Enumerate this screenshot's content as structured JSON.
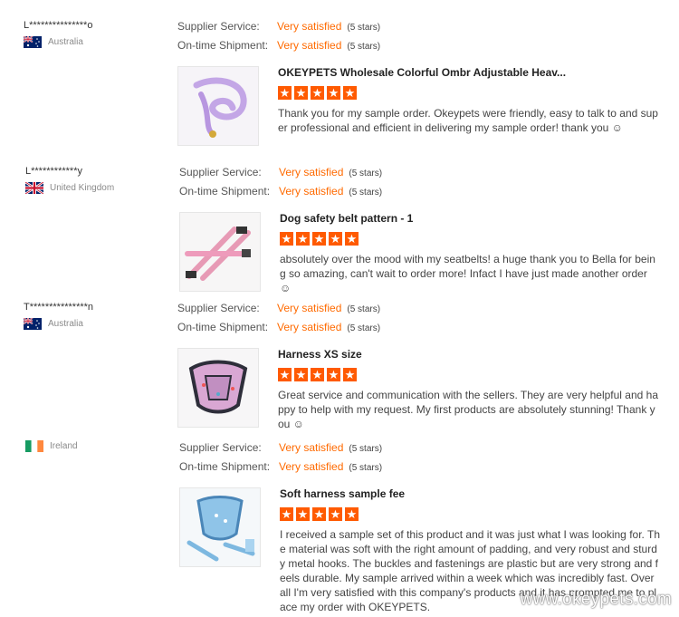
{
  "labels": {
    "supplier_service": "Supplier Service:",
    "ontime_shipment": "On-time Shipment:"
  },
  "accent_color": "#ff6a00",
  "star_color": "#ff5a00",
  "reviews": [
    {
      "buyer": "L***************o",
      "country": "Australia",
      "flag_icon": "australia-flag-icon",
      "supplier_value": "Very satisfied",
      "supplier_stars": "(5 stars)",
      "shipment_value": "Very satisfied",
      "shipment_stars": "(5 stars)",
      "product_title": "OKEYPETS Wholesale Colorful Ombr Adjustable Heav...",
      "rating": 5,
      "comment": "Thank you for my sample order. Okeypets were friendly, easy to talk to and super professional and efficient in delivering my sample order! thank you ☺"
    },
    {
      "buyer": "L************y",
      "country": "United Kingdom",
      "flag_icon": "united-kingdom-flag-icon",
      "supplier_value": "Very satisfied",
      "supplier_stars": "(5 stars)",
      "shipment_value": "Very satisfied",
      "shipment_stars": "(5 stars)",
      "product_title": "Dog safety belt pattern - 1",
      "rating": 5,
      "comment": "absolutely over the mood with my seatbelts! a huge thank you to Bella for being so amazing, can't wait to order more! Infact I have just made another order ☺"
    },
    {
      "buyer": "T***************n",
      "country": "Australia",
      "flag_icon": "australia-flag-icon",
      "supplier_value": "Very satisfied",
      "supplier_stars": "(5 stars)",
      "shipment_value": "Very satisfied",
      "shipment_stars": "(5 stars)",
      "product_title": "Harness XS size",
      "rating": 5,
      "comment": "Great service and communication with the sellers. They are very helpful and happy to help with my request. My first products are absolutely stunning! Thank you ☺"
    },
    {
      "buyer": "",
      "country": "Ireland",
      "flag_icon": "ireland-flag-icon",
      "supplier_value": "Very satisfied",
      "supplier_stars": "(5 stars)",
      "shipment_value": "Very satisfied",
      "shipment_stars": "(5 stars)",
      "product_title": "Soft harness sample fee",
      "rating": 5,
      "comment": "I received a sample set of this product and it was just what I was looking for. The material was soft with the right amount of padding, and very robust and sturdy metal hooks. The buckles and fastenings are plastic but are very strong and feels durable. My sample arrived within a week which was incredibly fast. Overall I'm very satisfied with this company's products and it has prompted me to place my order with OKEYPETS."
    }
  ],
  "watermark": "www.okeypets.com"
}
